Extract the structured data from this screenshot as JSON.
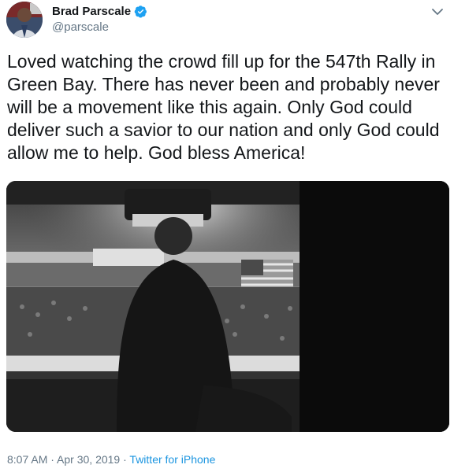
{
  "user": {
    "display_name": "Brad Parscale",
    "handle": "@parscale",
    "verified_icon": "verified-badge-icon"
  },
  "tweet": {
    "text": "Loved watching the crowd fill up for the 547th Rally in Green Bay. There has never been and probably never will be a movement like this again. Only God could deliver such a savior to our nation and only God could allow me to help. God bless America!"
  },
  "meta": {
    "time": "8:07 AM",
    "separator1": " · ",
    "date": "Apr 30, 2019",
    "separator2": " · ",
    "source": "Twitter for iPhone"
  },
  "colors": {
    "text": "#14171a",
    "secondary": "#657786",
    "link": "#1b95e0",
    "verified": "#1da1f2"
  }
}
